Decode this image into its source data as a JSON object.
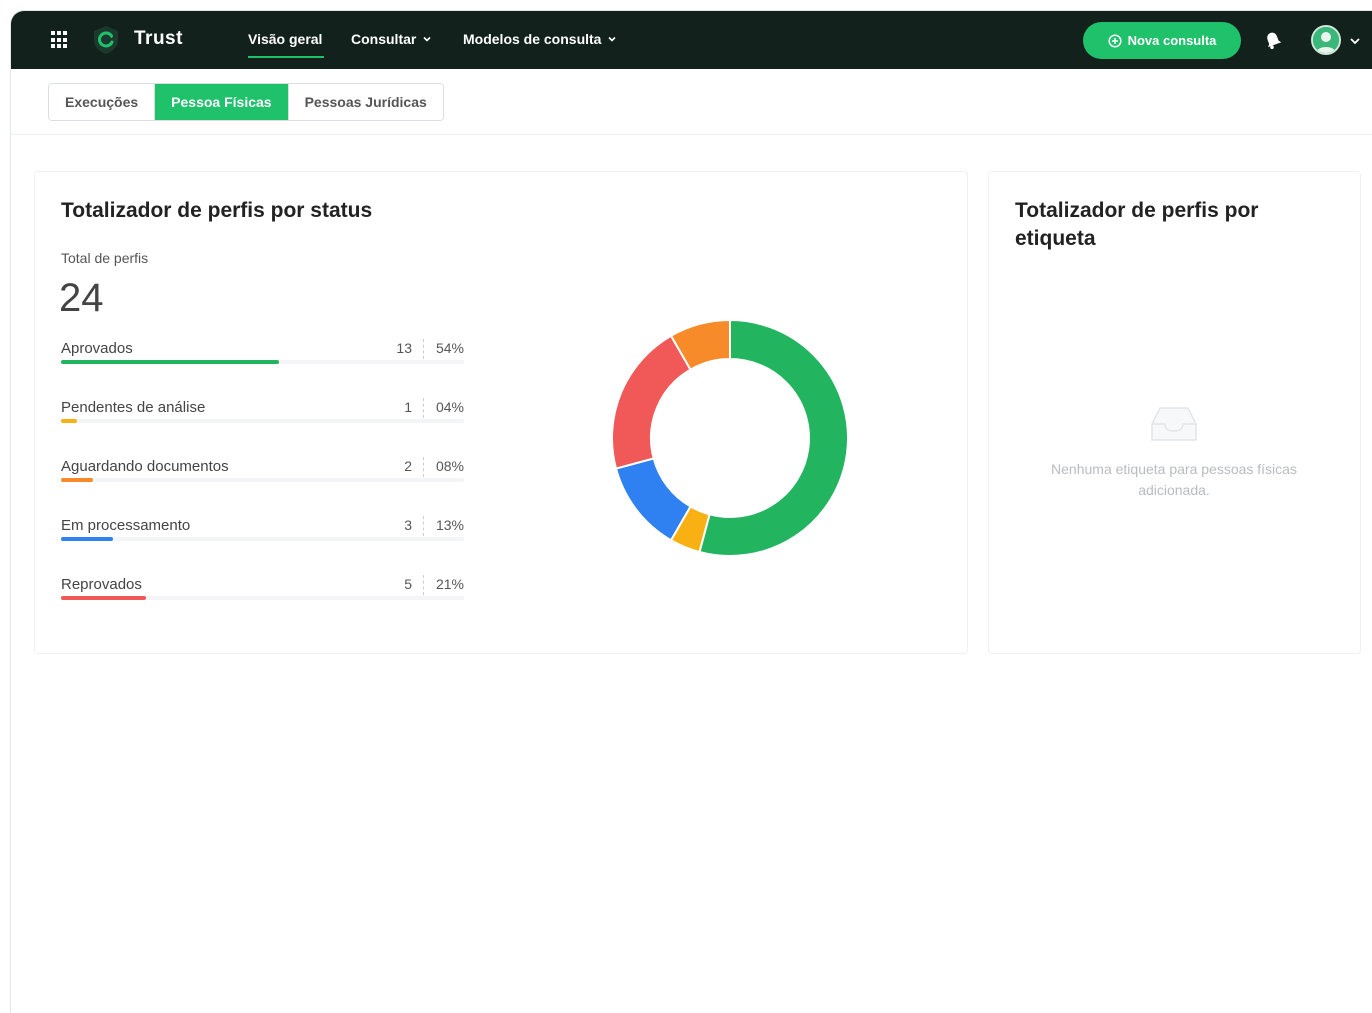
{
  "header": {
    "brand": "Trust",
    "nav": [
      {
        "label": "Visão geral",
        "active": true,
        "has_dropdown": false
      },
      {
        "label": "Consultar",
        "active": false,
        "has_dropdown": true
      },
      {
        "label": "Modelos de consulta",
        "active": false,
        "has_dropdown": true
      }
    ],
    "new_button_label": "Nova consulta",
    "icons": [
      "apps-grid-icon",
      "shield-logo-icon",
      "bell-icon",
      "avatar",
      "chevron-down-icon"
    ]
  },
  "tabs": [
    {
      "label": "Execuções",
      "active": false
    },
    {
      "label": "Pessoa Físicas",
      "active": true
    },
    {
      "label": "Pessoas Jurídicas",
      "active": false
    }
  ],
  "status_card": {
    "title": "Totalizador de perfis por status",
    "total_label": "Total de perfis",
    "total_value": "24",
    "items": [
      {
        "label": "Aprovados",
        "count": "13",
        "percent": "54%",
        "fraction": 0.54,
        "color": "#22b45f"
      },
      {
        "label": "Pendentes de análise",
        "count": "1",
        "percent": "04%",
        "fraction": 0.04,
        "color": "#f9b013"
      },
      {
        "label": "Aguardando documentos",
        "count": "2",
        "percent": "08%",
        "fraction": 0.08,
        "color": "#f78b2a"
      },
      {
        "label": "Em processamento",
        "count": "3",
        "percent": "13%",
        "fraction": 0.13,
        "color": "#2f80f0"
      },
      {
        "label": "Reprovados",
        "count": "5",
        "percent": "21%",
        "fraction": 0.21,
        "color": "#f15858"
      }
    ]
  },
  "chart_data": {
    "type": "pie",
    "donut": true,
    "categories": [
      "Aprovados",
      "Pendentes de análise",
      "Em processamento",
      "Reprovados",
      "Aguardando documentos"
    ],
    "values": [
      13,
      1,
      3,
      5,
      2
    ],
    "colors": [
      "#22b45f",
      "#f9b013",
      "#2f80f0",
      "#f15858",
      "#f78b2a"
    ]
  },
  "tags_card": {
    "title": "Totalizador de perfis por etiqueta",
    "empty_message": "Nenhuma etiqueta para pessoas físicas adicionada."
  }
}
